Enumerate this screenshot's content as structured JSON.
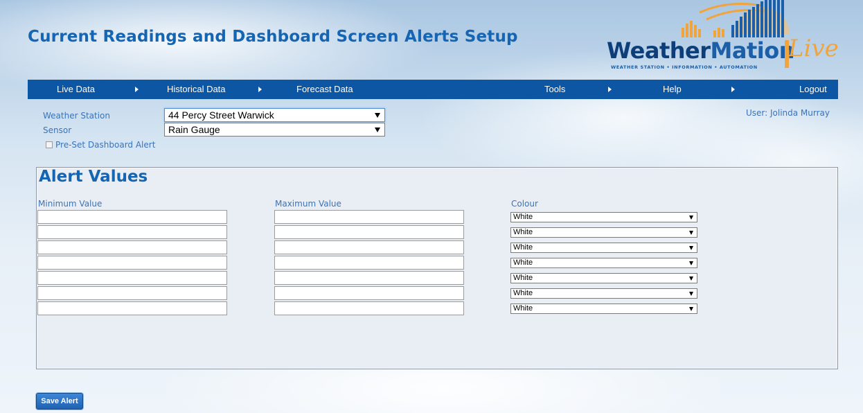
{
  "page": {
    "title": "Current Readings and Dashboard Screen Alerts Setup"
  },
  "logo": {
    "word_a": "Weather",
    "word_b": "Mation",
    "live": "Live",
    "tagline": "WEATHER STATION • INFORMATION • AUTOMATION"
  },
  "nav": {
    "items": [
      "Live Data",
      "Historical Data",
      "Forecast Data",
      "Tools",
      "Help",
      "Logout"
    ]
  },
  "form": {
    "station_label": "Weather Station",
    "station_value": "44 Percy Street Warwick",
    "sensor_label": "Sensor",
    "sensor_value": "Rain Gauge",
    "preset_label": "Pre-Set Dashboard Alert",
    "preset_checked": false,
    "user": "User: Jolinda Murray"
  },
  "alerts": {
    "title": "Alert Values",
    "min_header": "Minimum Value",
    "max_header": "Maximum Value",
    "colour_header": "Colour",
    "rows": [
      {
        "min": "",
        "max": "",
        "colour": "White"
      },
      {
        "min": "",
        "max": "",
        "colour": "White"
      },
      {
        "min": "",
        "max": "",
        "colour": "White"
      },
      {
        "min": "",
        "max": "",
        "colour": "White"
      },
      {
        "min": "",
        "max": "",
        "colour": "White"
      },
      {
        "min": "",
        "max": "",
        "colour": "White"
      },
      {
        "min": "",
        "max": "",
        "colour": "White"
      }
    ]
  },
  "actions": {
    "save": "Save Alert"
  },
  "colors": {
    "brand_blue": "#1565b3",
    "nav_blue": "#0d56a4",
    "logo_orange": "#f1a43b"
  }
}
